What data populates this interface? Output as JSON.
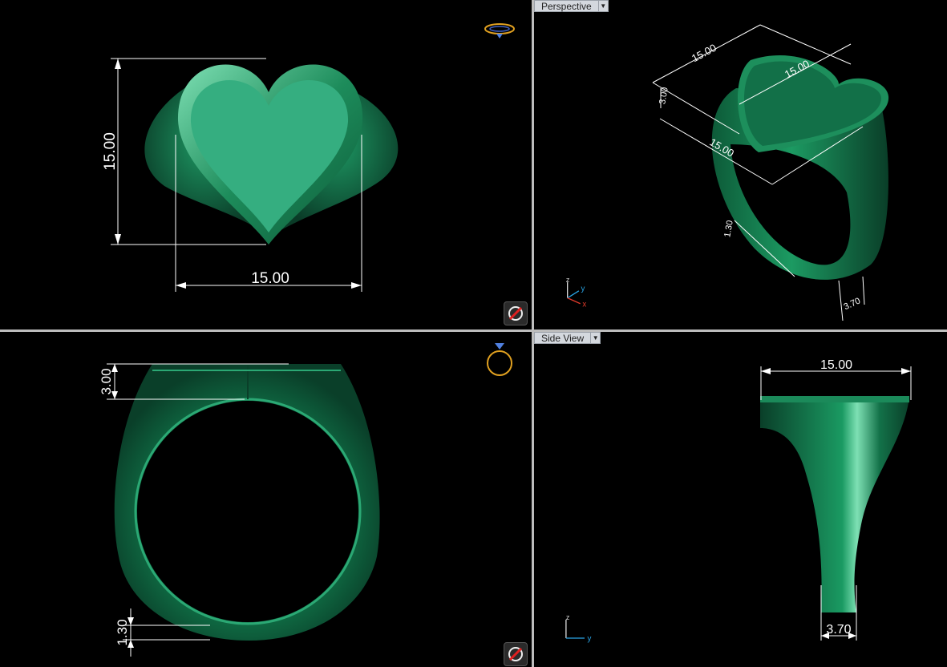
{
  "viewports": {
    "top": {
      "dims": {
        "height": "15.00",
        "width": "15.00"
      }
    },
    "perspective": {
      "tab_label": "Perspective",
      "dims": {
        "d1": "15.00",
        "d2": "15.00",
        "d3": "15.00",
        "d4": "3.00",
        "d5": "1.30",
        "d6": "3.70"
      }
    },
    "front": {
      "dims": {
        "top_thickness": "3.00",
        "band_thickness": "1.30"
      }
    },
    "side": {
      "tab_label": "Side View",
      "dims": {
        "width": "15.00",
        "bottom": "3.70"
      }
    }
  },
  "axis_labels": {
    "z": "z",
    "y": "y",
    "x": "x"
  },
  "colors": {
    "ring": "#1b8a5a",
    "ring_face": "#34ad80",
    "dim_lines": "#ffffff",
    "axis_z": "#d8d8d8",
    "axis_y": "#2aa5e6",
    "axis_x": "#e03a2a"
  }
}
